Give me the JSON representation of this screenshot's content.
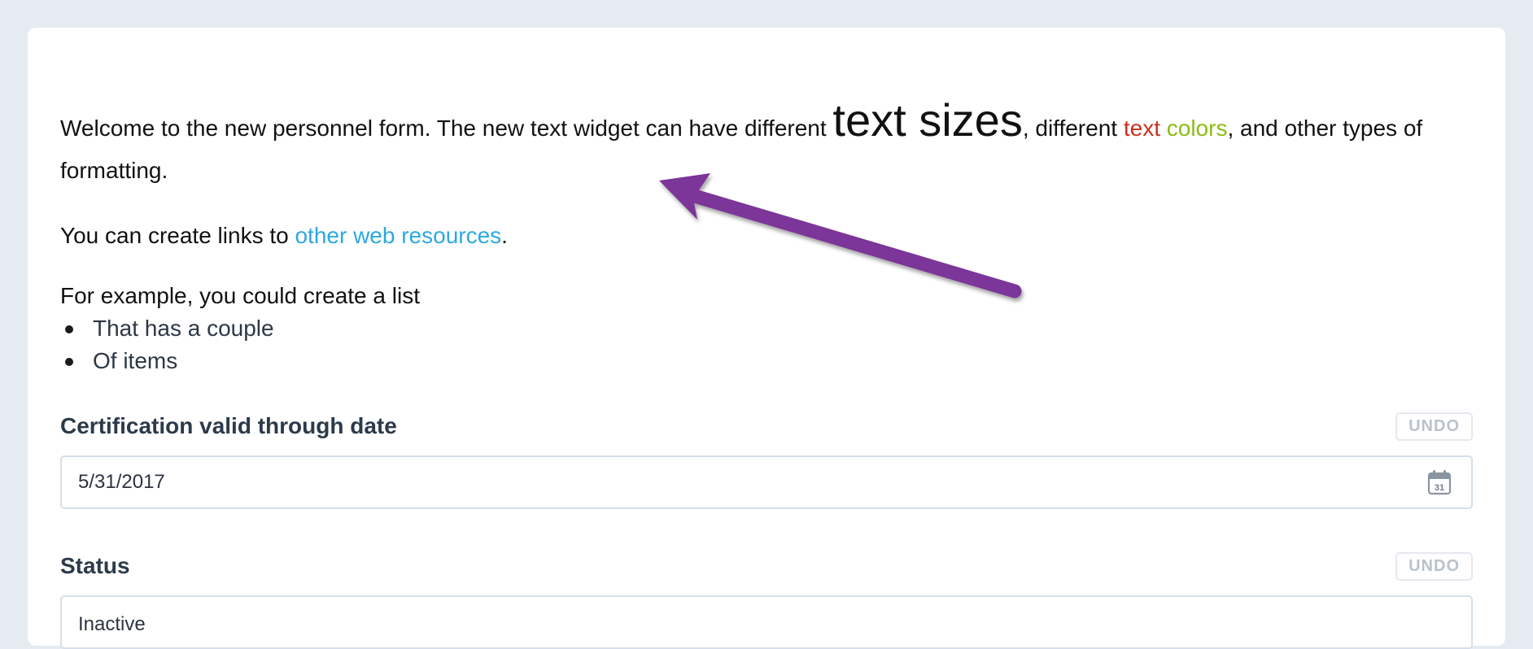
{
  "rich_text": {
    "p1_a": "Welcome to the new personnel form. The new text widget can have different ",
    "p1_big": "text sizes",
    "p1_b": ", different ",
    "p1_red": "text",
    "p1_space": " ",
    "p1_green": "colors",
    "p1_c": ", and other types of formatting.",
    "p2_a": "You can create links to ",
    "p2_link": "other web resources",
    "p2_b": ".",
    "p3": "For example, you could create a list",
    "list_items": [
      "That has a couple",
      "Of items"
    ]
  },
  "fields": [
    {
      "label": "Certification valid through date",
      "undo": "UNDO",
      "value": "5/31/2017",
      "icon": "calendar-icon",
      "icon_day": "31"
    },
    {
      "label": "Status",
      "undo": "UNDO",
      "value": "Inactive"
    }
  ],
  "colors": {
    "red_text": "#c8321e",
    "green_text": "#8cbc12",
    "link": "#2ea8e0",
    "arrow": "#7b3598"
  }
}
